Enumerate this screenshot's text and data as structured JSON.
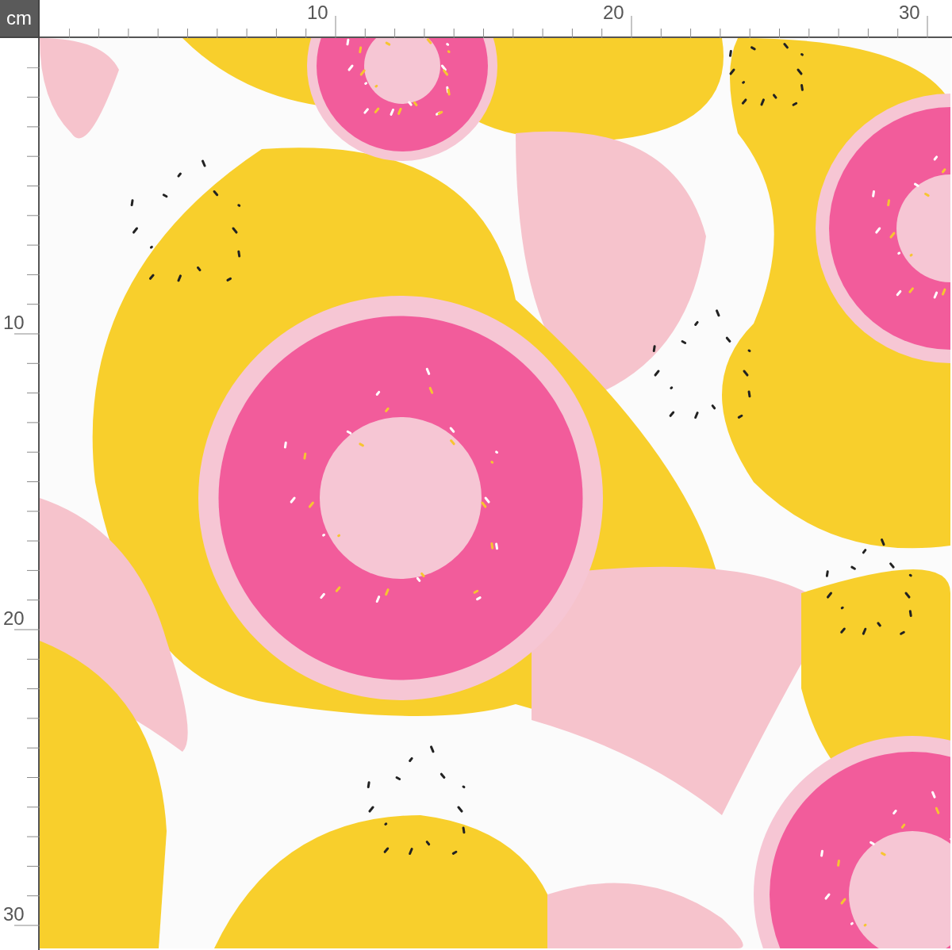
{
  "corner_unit": "cm",
  "top_ruler": {
    "labels": [
      "10",
      "20",
      "30"
    ]
  },
  "left_ruler": {
    "labels": [
      "10",
      "20",
      "30"
    ]
  }
}
